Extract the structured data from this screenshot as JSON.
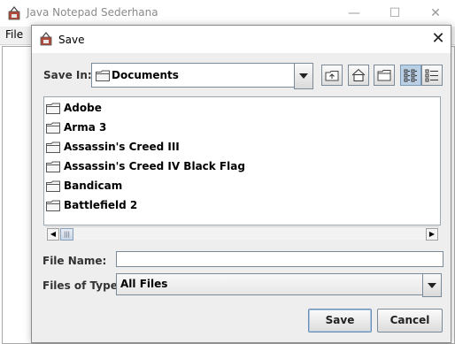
{
  "main_window": {
    "title": "Java Notepad Sederhana",
    "menu": {
      "file": "File"
    }
  },
  "dialog": {
    "title": "Save",
    "save_in": {
      "label": "Save In:",
      "value": "Documents"
    },
    "toolbar": {
      "buttons": [
        {
          "name": "up-one-level-icon"
        },
        {
          "name": "home-icon"
        },
        {
          "name": "new-folder-icon"
        },
        {
          "name": "list-view-icon",
          "active": true
        },
        {
          "name": "details-view-icon",
          "active": false
        }
      ]
    },
    "files": [
      {
        "name": "Adobe"
      },
      {
        "name": "Arma 3"
      },
      {
        "name": "Assassin's Creed III"
      },
      {
        "name": "Assassin's Creed IV Black Flag"
      },
      {
        "name": "Bandicam"
      },
      {
        "name": "Battlefield 2"
      }
    ],
    "file_name": {
      "label": "File Name:",
      "value": ""
    },
    "files_of_type": {
      "label": "Files of Type:",
      "value": "All Files"
    },
    "buttons": {
      "save": "Save",
      "cancel": "Cancel"
    }
  },
  "colors": {
    "accent": "#b8cfe5",
    "border": "#7a8a99",
    "dialog_bg": "#eeeeee"
  }
}
